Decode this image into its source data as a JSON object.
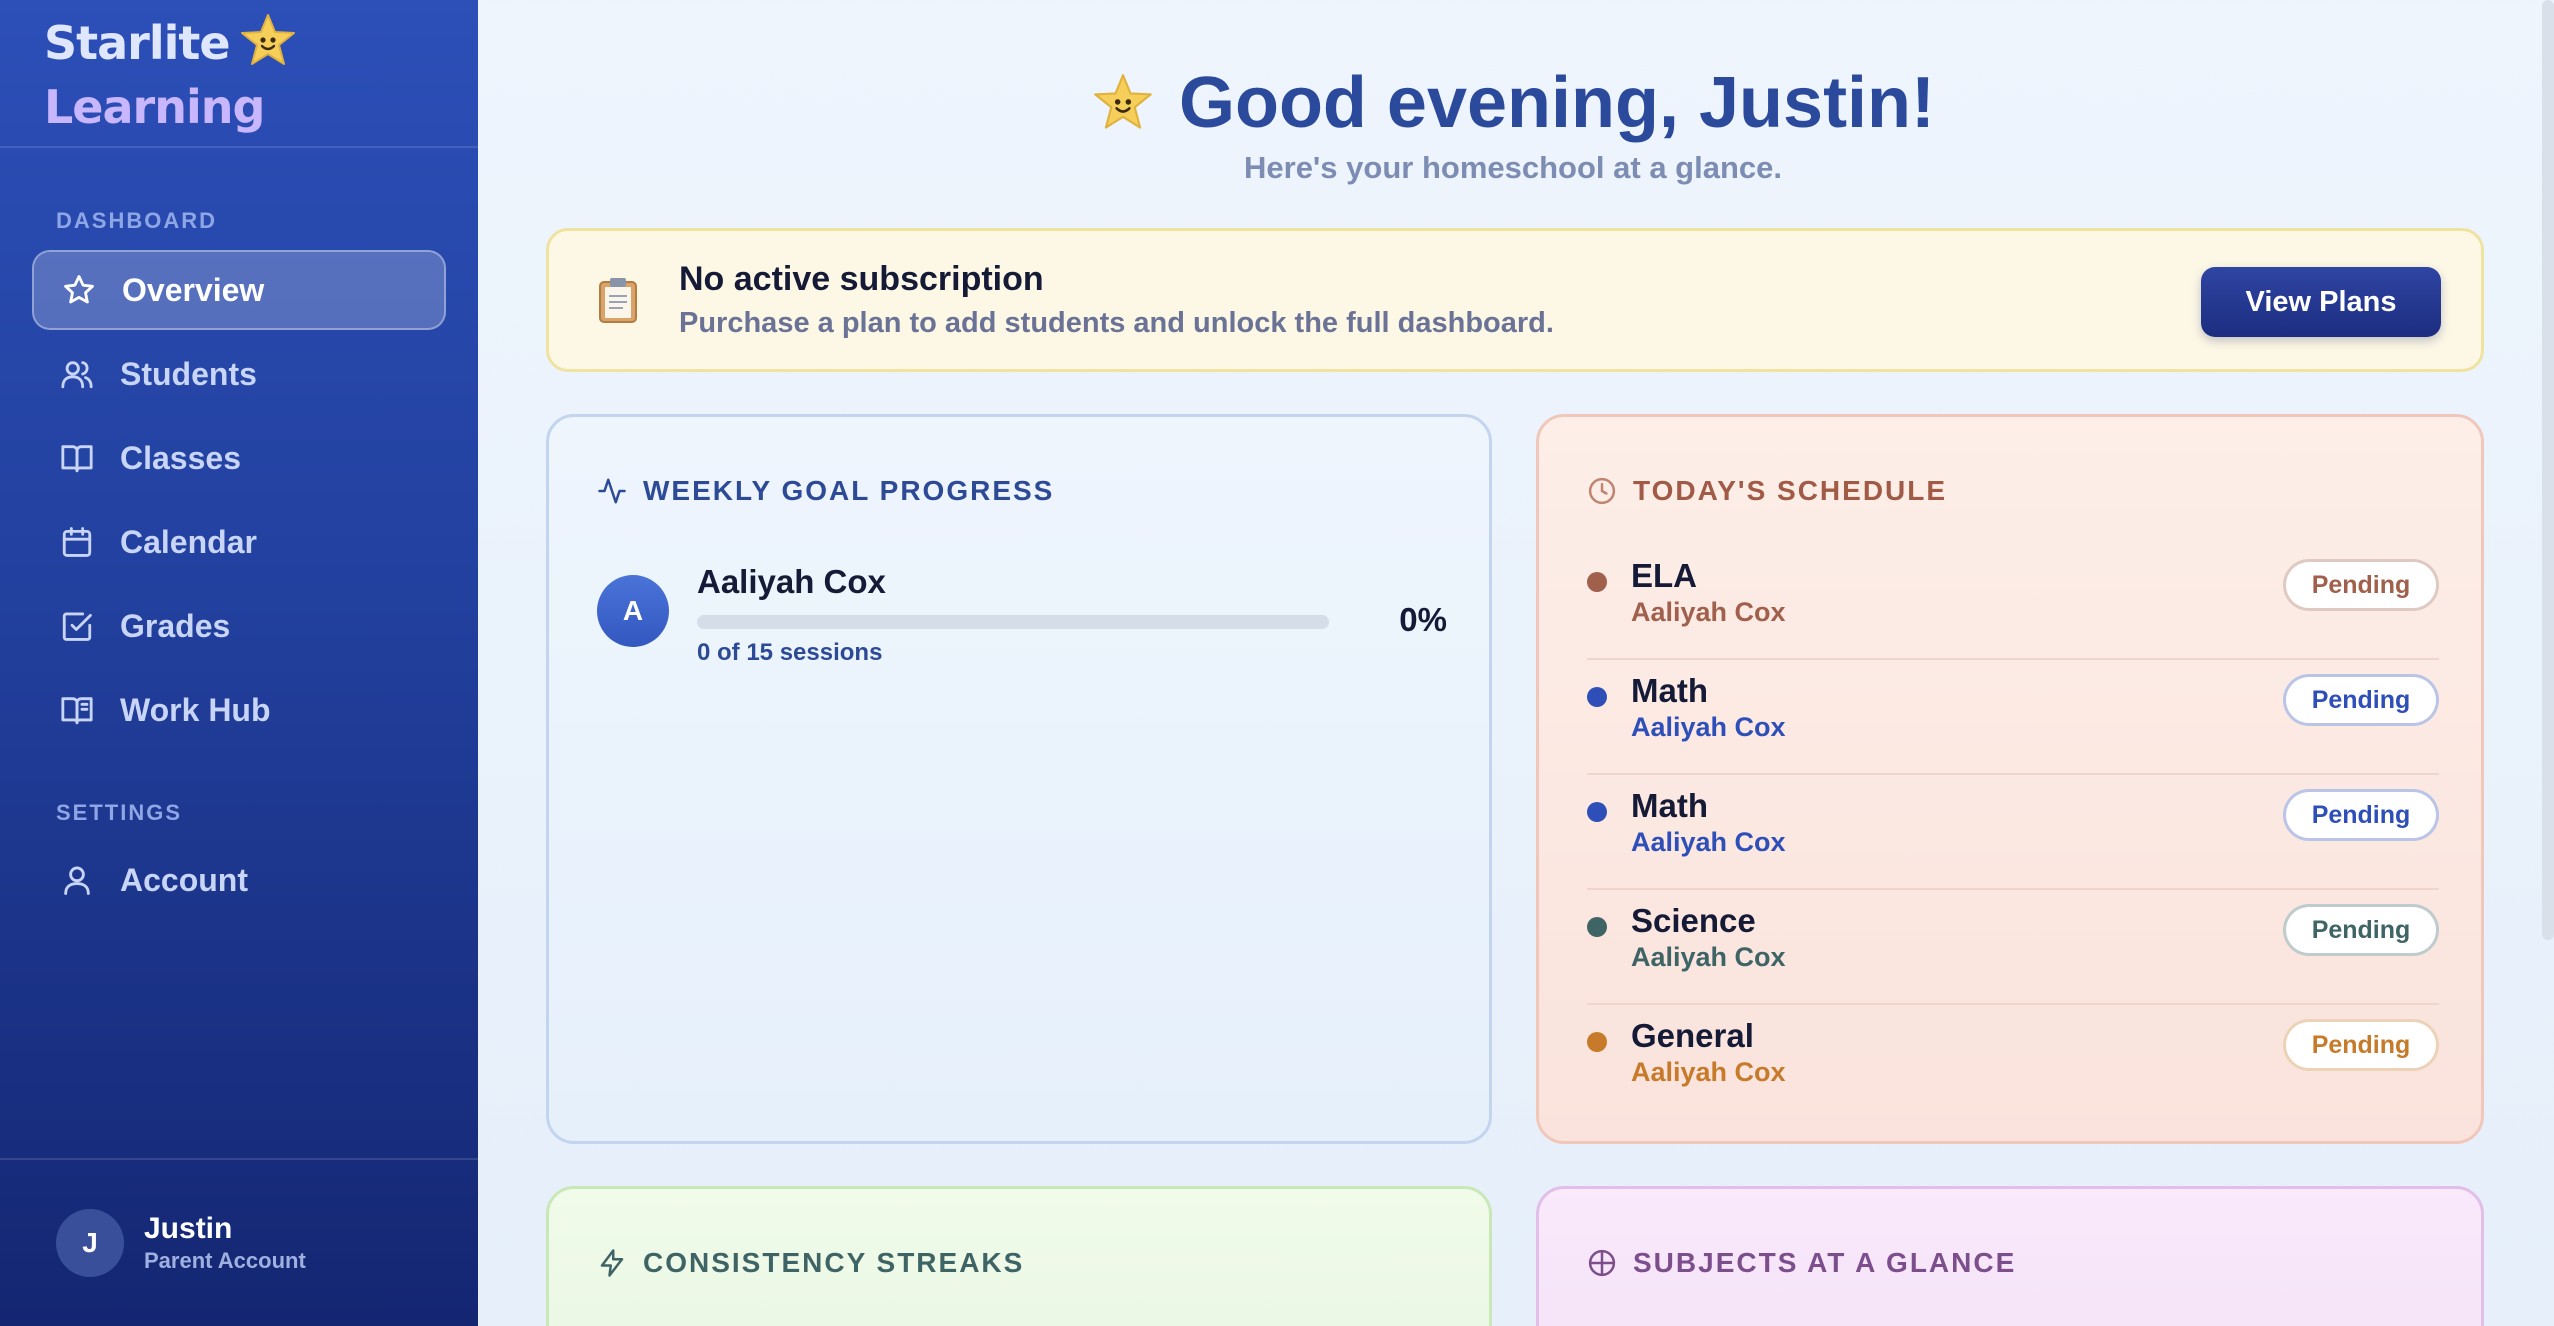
{
  "brand": {
    "name_part1": "Starlite",
    "name_part2": "Learning"
  },
  "sidebar": {
    "section_dashboard": "DASHBOARD",
    "section_settings": "SETTINGS",
    "items": [
      {
        "label": "Overview",
        "icon": "star-icon",
        "active": true
      },
      {
        "label": "Students",
        "icon": "users-icon"
      },
      {
        "label": "Classes",
        "icon": "book-open-icon"
      },
      {
        "label": "Calendar",
        "icon": "calendar-icon"
      },
      {
        "label": "Grades",
        "icon": "check-square-icon"
      },
      {
        "label": "Work Hub",
        "icon": "book-icon"
      }
    ],
    "settings_items": [
      {
        "label": "Account",
        "icon": "user-icon"
      }
    ],
    "user": {
      "initial": "J",
      "name": "Justin",
      "role": "Parent Account"
    }
  },
  "header": {
    "greeting": "Good evening, Justin!",
    "subtitle": "Here's your homeschool at a glance."
  },
  "banner": {
    "icon": "clipboard-icon",
    "title": "No active subscription",
    "message": "Purchase a plan to add students and unlock the full dashboard.",
    "button": "View Plans"
  },
  "weekly_goal": {
    "title": "WEEKLY GOAL PROGRESS",
    "students": [
      {
        "initial": "A",
        "name": "Aaliyah Cox",
        "sessions": "0 of 15 sessions",
        "percent_label": "0%",
        "progress": 0
      }
    ]
  },
  "schedule": {
    "title": "TODAY'S SCHEDULE",
    "items": [
      {
        "subject": "ELA",
        "student": "Aaliyah Cox",
        "status": "Pending",
        "color": "#a0604c"
      },
      {
        "subject": "Math",
        "student": "Aaliyah Cox",
        "status": "Pending",
        "color": "#2f4fb8"
      },
      {
        "subject": "Math",
        "student": "Aaliyah Cox",
        "status": "Pending",
        "color": "#2f4fb8"
      },
      {
        "subject": "Science",
        "student": "Aaliyah Cox",
        "status": "Pending",
        "color": "#3f6466"
      },
      {
        "subject": "General",
        "student": "Aaliyah Cox",
        "status": "Pending",
        "color": "#c67a2a"
      }
    ]
  },
  "streaks": {
    "title": "CONSISTENCY STREAKS"
  },
  "subjects": {
    "title": "SUBJECTS AT A GLANCE"
  },
  "colors": {
    "accent": "#2c4a9b",
    "sidebar_top": "#2c4fb8",
    "sidebar_bottom": "#142672"
  }
}
